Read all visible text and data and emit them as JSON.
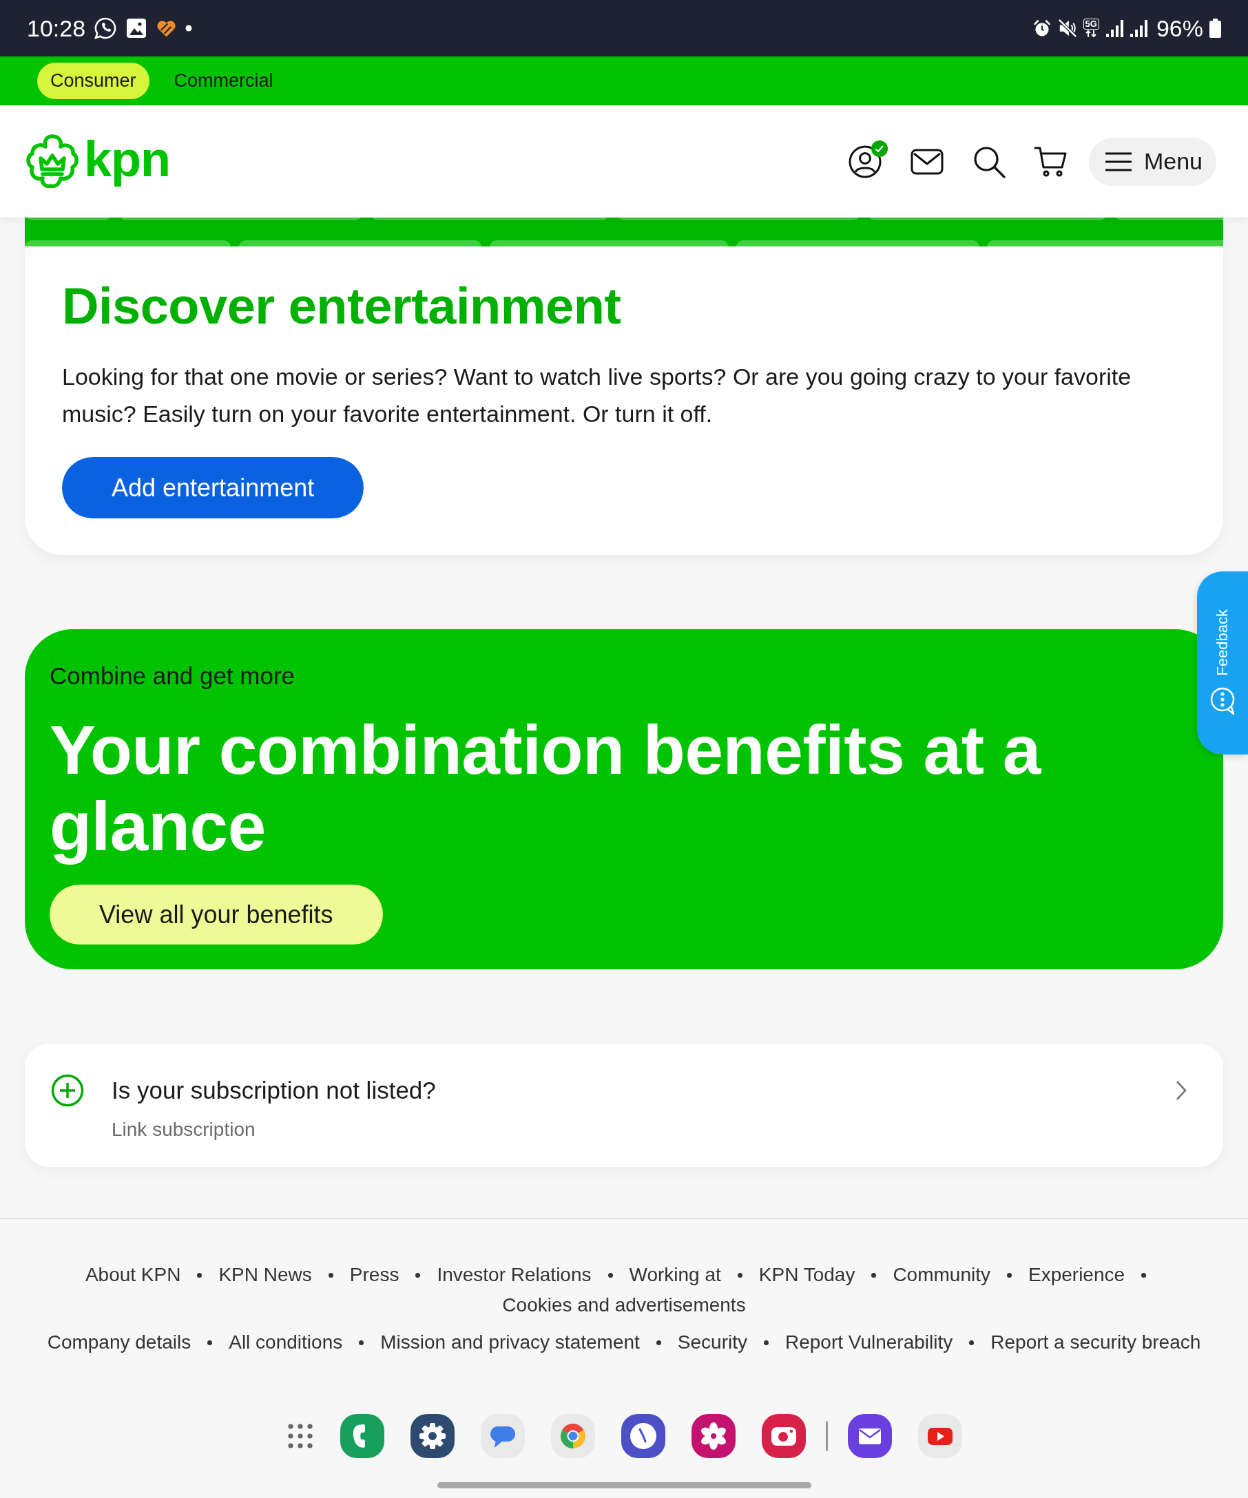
{
  "status_bar": {
    "time": "10:28",
    "network": "5G",
    "battery": "96%"
  },
  "segment_tabs": [
    {
      "label": "Consumer",
      "selected": true
    },
    {
      "label": "Commercial",
      "selected": false
    }
  ],
  "header": {
    "logo": "kpn",
    "account_verified": true,
    "menu": "Menu"
  },
  "entertainment_card": {
    "title": "Discover entertainment",
    "text": "Looking for that one movie or series? Want to watch live sports? Or are you going crazy to your favorite music? Easily turn on your favorite entertainment. Or turn it off.",
    "button": "Add entertainment"
  },
  "combination_banner": {
    "eyebrow": "Combine and get more",
    "title": "Your combination benefits at a glance",
    "button": "View all your benefits"
  },
  "feedback_tab": {
    "label": "Feedback"
  },
  "subscription_link": {
    "title": "Is your subscription not listed?",
    "subtitle": "Link subscription"
  },
  "footer": {
    "links_primary": [
      "About KPN",
      "KPN News",
      "Press",
      "Investor Relations",
      "Working at",
      "KPN Today",
      "Community",
      "Experience",
      "Cookies and advertisements"
    ],
    "links_secondary": [
      "Company details",
      "All conditions",
      "Mission and privacy statement",
      "Security",
      "Report Vulnerability",
      "Report a security breach"
    ]
  },
  "dock": {
    "apps": [
      {
        "kind": "apps"
      },
      {
        "kind": "phone"
      },
      {
        "kind": "settings"
      },
      {
        "kind": "messages"
      },
      {
        "kind": "browser"
      },
      {
        "kind": "clock"
      },
      {
        "kind": "gallery"
      },
      {
        "kind": "camera"
      },
      {
        "kind": "separator"
      },
      {
        "kind": "email"
      },
      {
        "kind": "video"
      }
    ]
  }
}
